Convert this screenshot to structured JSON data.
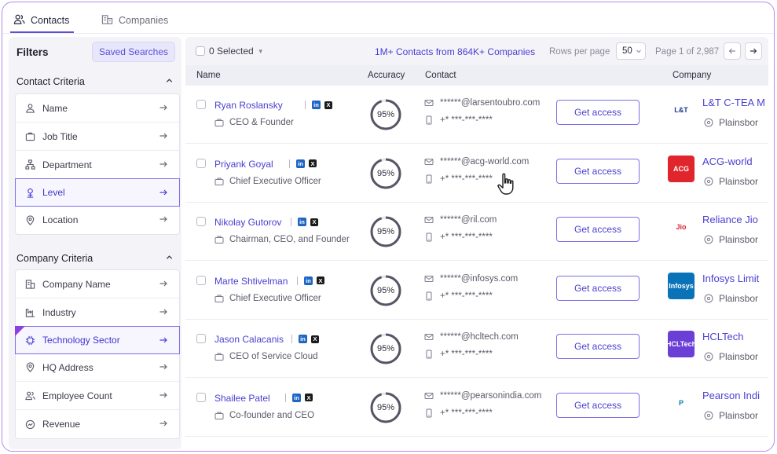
{
  "tabs": [
    {
      "label": "Contacts",
      "icon": "contacts-icon",
      "active": true
    },
    {
      "label": "Companies",
      "icon": "companies-icon",
      "active": false
    }
  ],
  "sidebar": {
    "title": "Filters",
    "saved_searches": "Saved Searches",
    "contact_criteria": {
      "title": "Contact Criteria",
      "items": [
        {
          "label": "Name",
          "icon": "person-icon"
        },
        {
          "label": "Job Title",
          "icon": "briefcase-icon"
        },
        {
          "label": "Department",
          "icon": "org-chart-icon"
        },
        {
          "label": "Level",
          "icon": "level-icon",
          "selected": true
        },
        {
          "label": "Location",
          "icon": "location-pin-icon"
        }
      ]
    },
    "company_criteria": {
      "title": "Company Criteria",
      "items": [
        {
          "label": "Company Name",
          "icon": "building-icon"
        },
        {
          "label": "Industry",
          "icon": "factory-icon"
        },
        {
          "label": "Technology Sector",
          "icon": "chip-icon",
          "selected": true,
          "badge": true
        },
        {
          "label": "HQ Address",
          "icon": "location-pin-icon"
        },
        {
          "label": "Employee Count",
          "icon": "people-icon"
        },
        {
          "label": "Revenue",
          "icon": "revenue-icon"
        }
      ]
    }
  },
  "toolbar": {
    "selected": "0 Selected",
    "count_text": "1M+ Contacts from 864K+ Companies",
    "rows_per_page_label": "Rows per page",
    "rows_per_page_value": "50",
    "page_info": "Page 1 of 2,987"
  },
  "table": {
    "headers": {
      "name": "Name",
      "accuracy": "Accuracy",
      "contact": "Contact",
      "company": "Company"
    },
    "get_access_label": "Get access",
    "rows": [
      {
        "name": "Ryan Roslansky",
        "title": "CEO & Founder",
        "accuracy": "95%",
        "accuracy_value": 0.95,
        "email": "******@larsentoubro.com",
        "phone": "+* ***-***-****",
        "company": "L&T C-TEA M",
        "location": "Plainsbor",
        "logo_text": "L&T",
        "logo_bg": "#ffffff",
        "logo_fg": "#1d3d8f"
      },
      {
        "name": "Priyank Goyal",
        "title": "Chief Executive Officer",
        "accuracy": "95%",
        "accuracy_value": 0.95,
        "email": "******@acg-world.com",
        "phone": "+* ***-***-****",
        "company": "ACG-world",
        "location": "Plainsbor",
        "logo_text": "ACG",
        "logo_bg": "#e0262c",
        "logo_fg": "#ffffff"
      },
      {
        "name": "Nikolay Gutorov",
        "title": "Chairman, CEO, and Founder",
        "accuracy": "95%",
        "accuracy_value": 0.95,
        "email": "******@ril.com",
        "phone": "+* ***-***-****",
        "company": "Reliance Jio",
        "location": "Plainsbor",
        "logo_text": "Jio",
        "logo_bg": "#ffffff",
        "logo_fg": "#d9232d"
      },
      {
        "name": "Marte Shtivelman",
        "title": "Chief Executive Officer",
        "accuracy": "95%",
        "accuracy_value": 0.95,
        "email": "******@infosys.com",
        "phone": "+* ***-***-****",
        "company": "Infosys Limit",
        "location": "Plainsbor",
        "logo_text": "Infosys",
        "logo_bg": "#0a73b8",
        "logo_fg": "#ffffff"
      },
      {
        "name": "Jason Calacanis",
        "title": "CEO of Service Cloud",
        "accuracy": "95%",
        "accuracy_value": 0.95,
        "email": "******@hcltech.com",
        "phone": "+* ***-***-****",
        "company": "HCLTech",
        "location": "Plainsbor",
        "logo_text": "HCLTech",
        "logo_bg": "#6a3fd6",
        "logo_fg": "#ffffff"
      },
      {
        "name": "Shailee Patel",
        "title": "Co-founder and CEO",
        "accuracy": "95%",
        "accuracy_value": 0.95,
        "email": "******@pearsonindia.com",
        "phone": "+* ***-***-****",
        "company": "Pearson Indi",
        "location": "Plainsbor",
        "logo_text": "P",
        "logo_bg": "#ffffff",
        "logo_fg": "#0a7fa8"
      }
    ]
  },
  "colors": {
    "accent": "#4a3fd0",
    "border": "#b48bea",
    "ring": "#555566"
  }
}
